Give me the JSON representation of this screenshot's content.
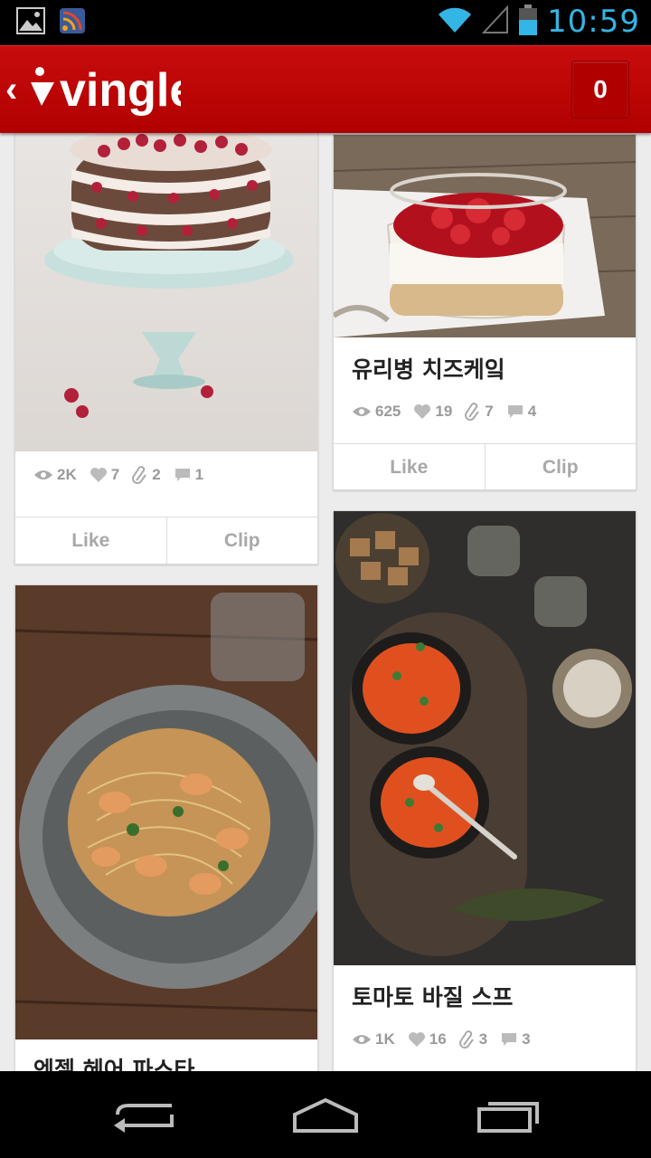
{
  "status_bar": {
    "time": "10:59"
  },
  "app": {
    "logo_text": "vingle",
    "counter": "0"
  },
  "cards": {
    "pavlova": {
      "stats": {
        "views": "2K",
        "likes": "7",
        "clips": "2",
        "comments": "1"
      },
      "actions": {
        "like": "Like",
        "clip": "Clip"
      }
    },
    "cheesecake": {
      "title": "유리병 치즈케잌",
      "stats": {
        "views": "625",
        "likes": "19",
        "clips": "7",
        "comments": "4"
      },
      "actions": {
        "like": "Like",
        "clip": "Clip"
      }
    },
    "pasta": {
      "title": "엔젤 헤어 파스타"
    },
    "soup": {
      "title": "토마토 바질 스프",
      "stats": {
        "views": "1K",
        "likes": "16",
        "clips": "3",
        "comments": "3"
      }
    }
  },
  "colors": {
    "brand_red": "#c80c0c",
    "status_blue": "#33b5e5"
  }
}
